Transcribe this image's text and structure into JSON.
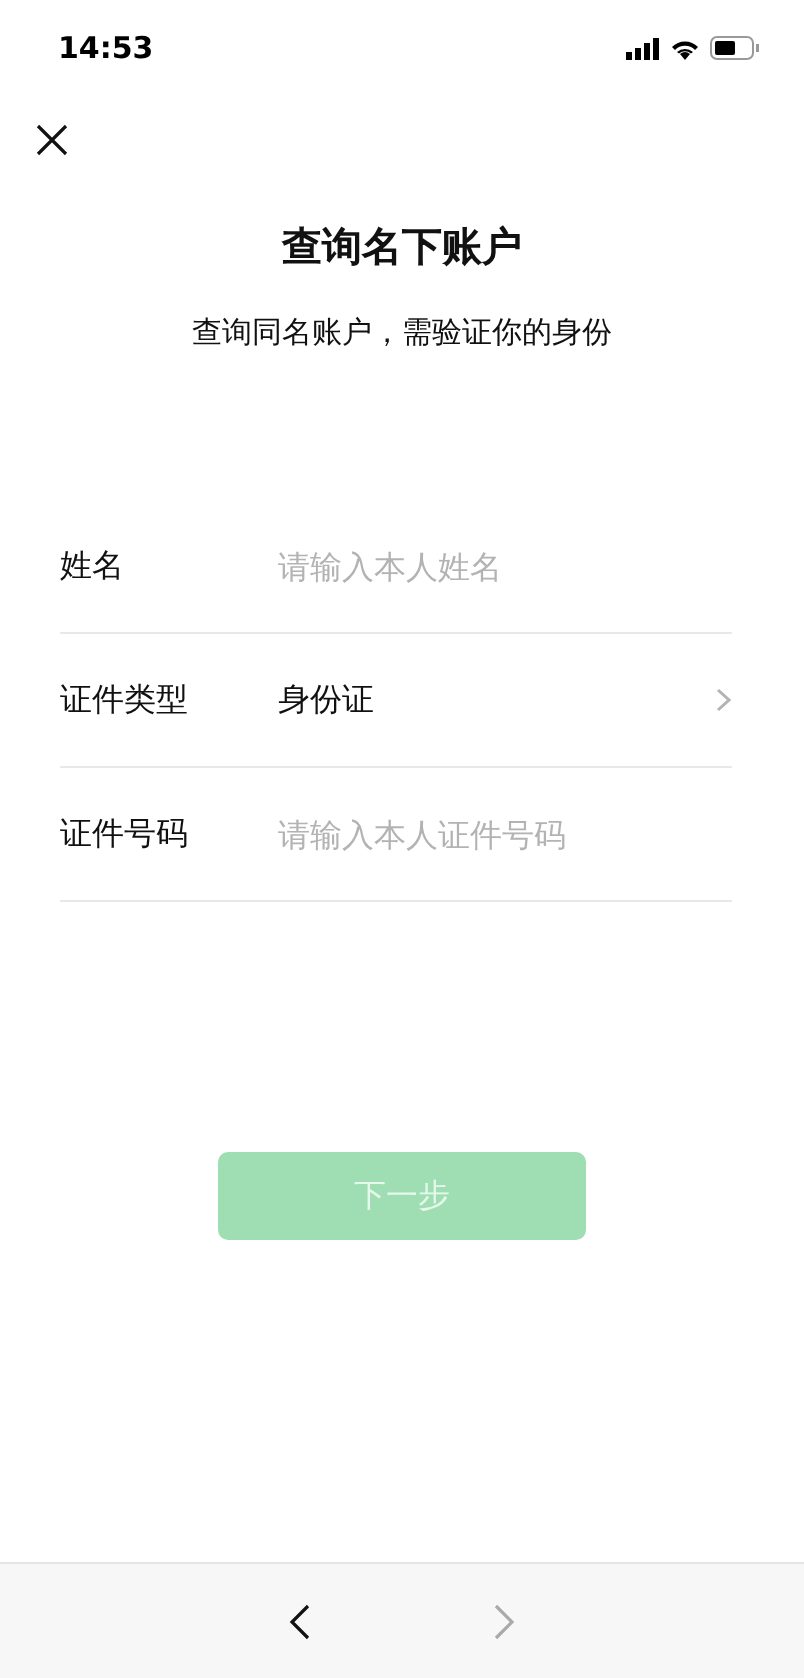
{
  "status_bar": {
    "time": "14:53"
  },
  "title": "查询名下账户",
  "subtitle": "查询同名账户，需验证你的身份",
  "fields": [
    {
      "kind": "input",
      "label": "姓名",
      "placeholder": "请输入本人姓名"
    },
    {
      "kind": "select",
      "label": "证件类型",
      "value": "身份证"
    },
    {
      "kind": "input",
      "label": "证件号码",
      "placeholder": "请输入本人证件号码"
    }
  ],
  "next_button": {
    "label": "下一步",
    "disabled": true
  },
  "bottom_nav": {
    "back_disabled": false,
    "forward_disabled": true
  }
}
